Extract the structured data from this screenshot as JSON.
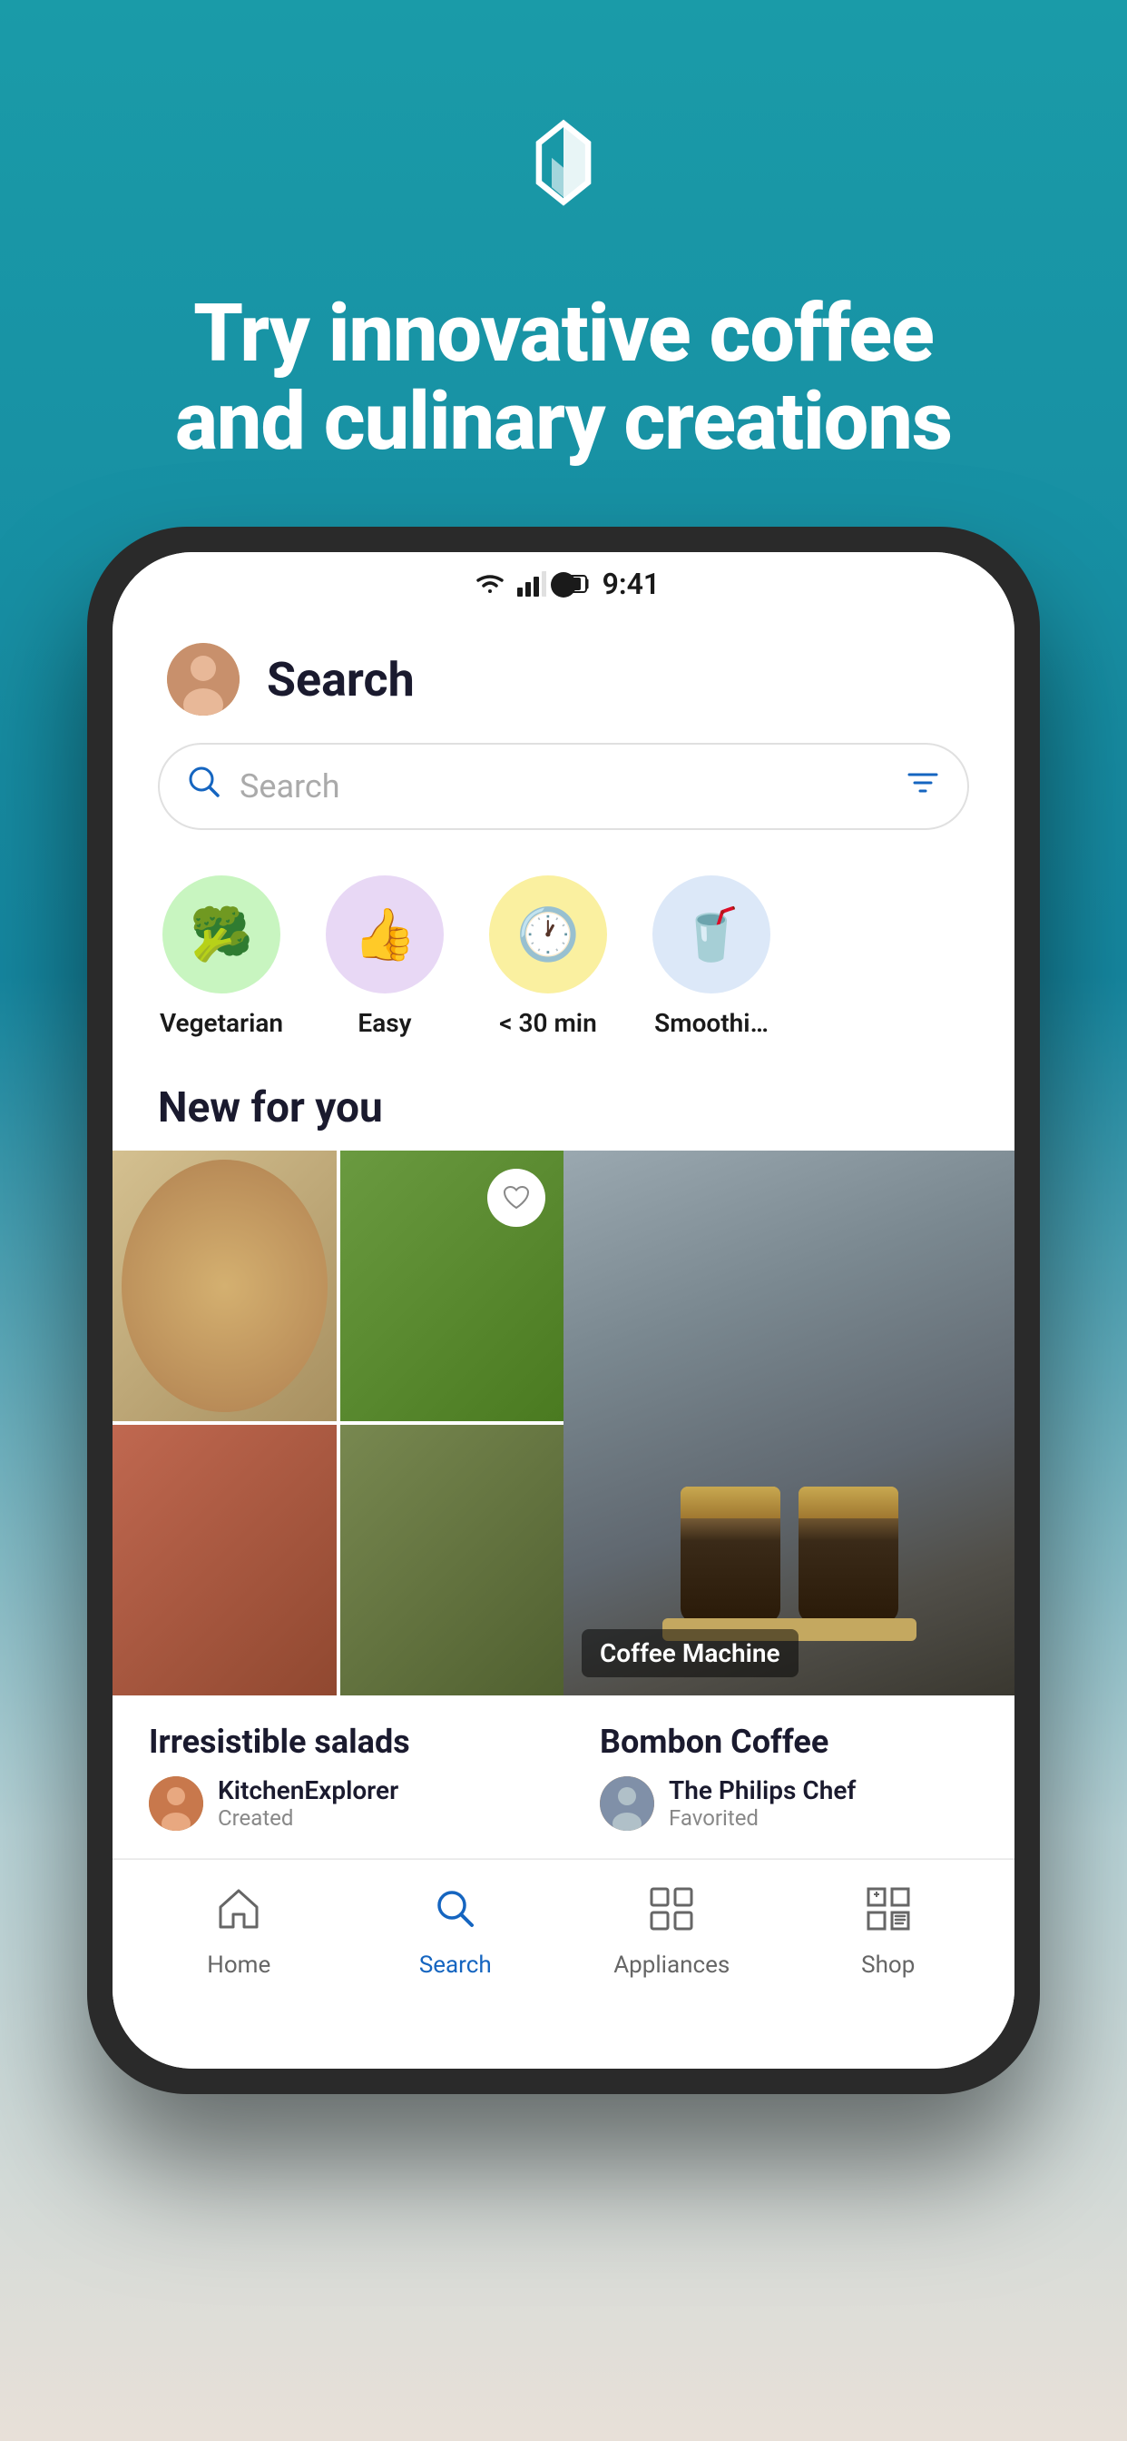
{
  "hero": {
    "tagline_line1": "Try innovative coffee",
    "tagline_line2": "and culinary creations"
  },
  "status_bar": {
    "time": "9:41"
  },
  "app_header": {
    "title": "Search"
  },
  "search": {
    "placeholder": "Search"
  },
  "categories": [
    {
      "id": "vegetarian",
      "label": "Vegetarian",
      "emoji": "🥦",
      "color": "green"
    },
    {
      "id": "easy",
      "label": "Easy",
      "emoji": "👍",
      "color": "purple"
    },
    {
      "id": "quick",
      "label": "< 30 min",
      "emoji": "🕐",
      "color": "yellow"
    },
    {
      "id": "smoothie",
      "label": "Smoothi…",
      "emoji": "🥤",
      "color": "blue-light"
    }
  ],
  "new_for_you": {
    "section_title": "New for you",
    "cards": [
      {
        "id": "irresistible-salads",
        "name": "Irresistible salads",
        "author": "KitchenExplorer",
        "action": "Created"
      },
      {
        "id": "bombon-coffee",
        "name": "Bombon Coffee",
        "badge": "Coffee Machine",
        "author": "The Philips Chef",
        "action": "Favorited"
      }
    ]
  },
  "bottom_nav": {
    "items": [
      {
        "id": "home",
        "label": "Home",
        "icon": "🏠",
        "active": false
      },
      {
        "id": "search",
        "label": "Search",
        "icon": "🔍",
        "active": true
      },
      {
        "id": "appliances",
        "label": "Appliances",
        "icon": "⊞",
        "active": false
      },
      {
        "id": "shop",
        "label": "Shop",
        "icon": "🏪",
        "active": false
      }
    ]
  }
}
